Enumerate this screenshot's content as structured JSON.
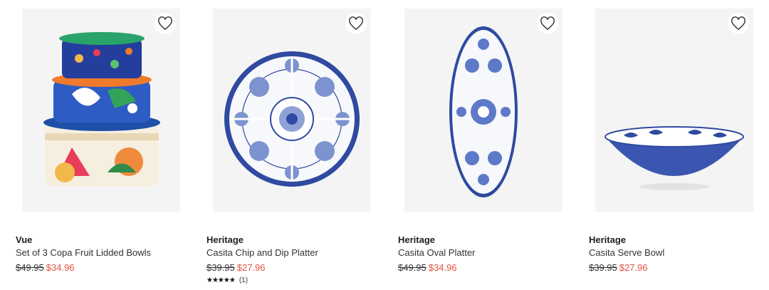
{
  "products": [
    {
      "brand": "Vue",
      "title": "Set of 3 Copa Fruit Lidded Bowls",
      "old_price": "$49.95",
      "new_price": "$34.96"
    },
    {
      "brand": "Heritage",
      "title": "Casita Chip and Dip Platter",
      "old_price": "$39.95",
      "new_price": "$27.96",
      "stars": "★★★★★",
      "review_count": "(1)"
    },
    {
      "brand": "Heritage",
      "title": "Casita Oval Platter",
      "old_price": "$49.95",
      "new_price": "$34.96"
    },
    {
      "brand": "Heritage",
      "title": "Casita Serve Bowl",
      "old_price": "$39.95",
      "new_price": "$27.96"
    }
  ],
  "colors": {
    "sale_price": "#e2533d",
    "accent_blue": "#2f4aa0"
  }
}
